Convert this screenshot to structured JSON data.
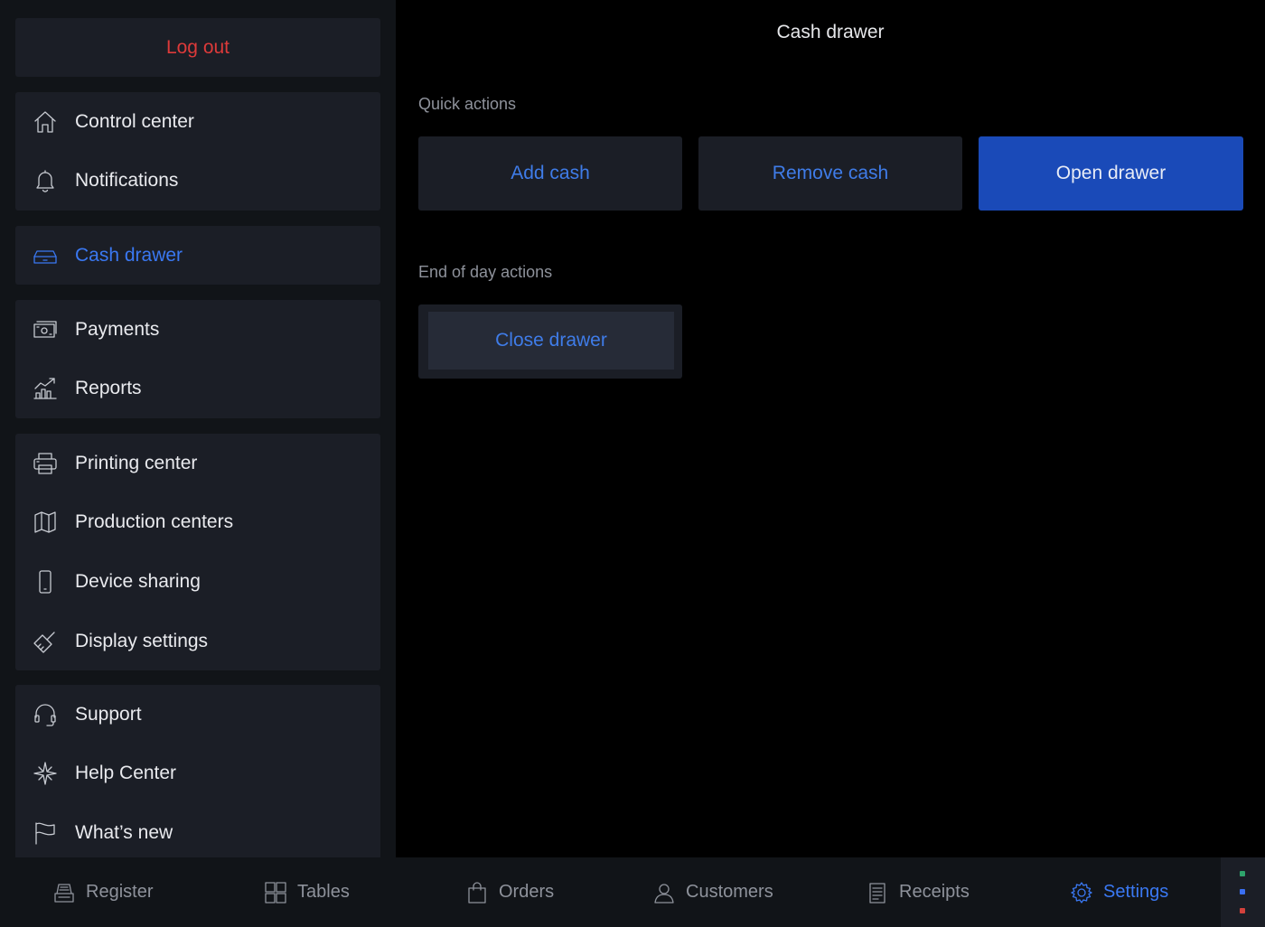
{
  "sidebar": {
    "logout_label": "Log out",
    "groups": [
      [
        {
          "label": "Control center",
          "icon": "home-icon"
        },
        {
          "label": "Notifications",
          "icon": "bell-icon"
        }
      ],
      [
        {
          "label": "Cash drawer",
          "icon": "cash-drawer-icon",
          "active": true
        }
      ],
      [
        {
          "label": "Payments",
          "icon": "banknote-icon"
        },
        {
          "label": "Reports",
          "icon": "chart-icon"
        }
      ],
      [
        {
          "label": "Printing center",
          "icon": "printer-icon"
        },
        {
          "label": "Production centers",
          "icon": "map-icon"
        },
        {
          "label": "Device sharing",
          "icon": "phone-icon"
        },
        {
          "label": "Display settings",
          "icon": "brush-icon"
        }
      ],
      [
        {
          "label": "Support",
          "icon": "headset-icon"
        },
        {
          "label": "Help Center",
          "icon": "compass-icon"
        },
        {
          "label": "What’s new",
          "icon": "flag-icon"
        }
      ]
    ]
  },
  "main": {
    "title": "Cash drawer",
    "quick_actions_label": "Quick actions",
    "quick_actions": {
      "add_cash": "Add cash",
      "remove_cash": "Remove cash",
      "open_drawer": "Open drawer"
    },
    "end_of_day_label": "End of day actions",
    "close_drawer": "Close drawer"
  },
  "tabbar": {
    "register": "Register",
    "tables": "Tables",
    "orders": "Orders",
    "customers": "Customers",
    "receipts": "Receipts",
    "settings": "Settings",
    "active": "Settings"
  },
  "colors": {
    "accent": "#3a78f2",
    "primary_button": "#1a4ab8",
    "logout": "#dd3a3a",
    "status_dots": [
      "#2ea36b",
      "#3a6ff2",
      "#d2413c"
    ]
  }
}
